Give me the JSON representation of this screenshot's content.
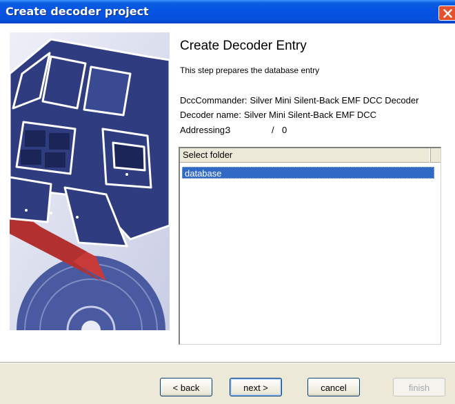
{
  "window": {
    "title": "Create decoder project"
  },
  "main": {
    "heading": "Create Decoder Entry",
    "subtitle": "This step prepares the database entry",
    "dcc_commander_label": "DccCommander:",
    "dcc_commander_value": "Silver Mini Silent-Back EMF DCC Decoder",
    "decoder_name_label": "Decoder name:",
    "decoder_name_value": "Silver Mini Silent-Back EMF DCC",
    "addressing_label": "Addressing:",
    "addressing_primary": "3",
    "addressing_separator": "/",
    "addressing_secondary": "0"
  },
  "folder_list": {
    "header": "Select folder",
    "items": [
      {
        "label": "database",
        "selected": true
      }
    ]
  },
  "buttons": {
    "back": "< back",
    "next": "next >",
    "cancel": "cancel",
    "finish": "finish"
  },
  "colors": {
    "titlebar": "#0554e3",
    "selection": "#316ac5",
    "graphic_navy": "#2f3d80",
    "graphic_red": "#c8393a",
    "close_button": "#e3512f"
  }
}
